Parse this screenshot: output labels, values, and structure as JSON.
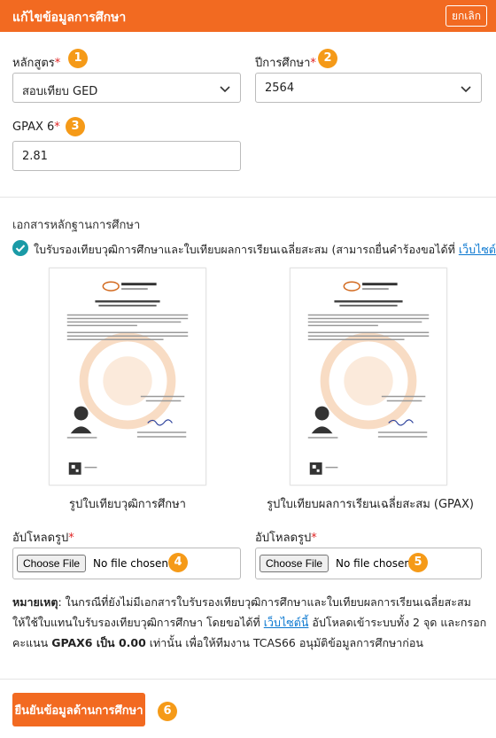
{
  "header": {
    "title": "แก้ไขข้อมูลการศึกษา",
    "cancel_label": "ยกเลิก"
  },
  "form": {
    "curriculum": {
      "label": "หลักสูตร",
      "required_mark": "*",
      "value": "สอบเทียบ GED",
      "badge": "1"
    },
    "year": {
      "label": "ปีการศึกษา",
      "required_mark": "*",
      "value": "2564",
      "badge": "2"
    },
    "gpax": {
      "label": "GPAX 6",
      "required_mark": "*",
      "value": "2.81",
      "badge": "3"
    }
  },
  "documents": {
    "section_title": "เอกสารหลักฐานการศึกษา",
    "checkbox_text_before": "ใบรับรองเทียบวุฒิการศึกษาและใบเทียบผลการเรียนเฉลี่ยสะสม (สามารถยื่นคำร้องขอได้ที่ ",
    "checkbox_link": "เว็บไซต์นี้",
    "checkbox_text_after": ")",
    "caption_left": "รูปใบเทียบวุฒิการศึกษา",
    "caption_right": "รูปใบเทียบผลการเรียนเฉลี่ยสะสม (GPAX)",
    "upload_left": {
      "label": "อัปโหลดรูป",
      "required_mark": "*",
      "button": "Choose File",
      "status": "No file chosen",
      "badge": "4"
    },
    "upload_right": {
      "label": "อัปโหลดรูป",
      "required_mark": "*",
      "button": "Choose File",
      "status": "No file chosen",
      "badge": "5"
    }
  },
  "note": {
    "prefix": "หมายเหตุ",
    "text1": ": ในกรณีที่ยังไม่มีเอกสารใบรับรองเทียบวุฒิการศึกษาและใบเทียบผลการเรียนเฉลี่ยสะสม ให้ใช้ใบแทนใบรับรองเทียบวุฒิการศึกษา โดยขอได้ที่ ",
    "link": "เว็บไซต์นี้",
    "text2": " อัปโหลดเข้าระบบทั้ง 2 จุด และกรอกคะแนน ",
    "bold": "GPAX6 เป็น 0.00",
    "text3": " เท่านั้น เพื่อให้ทีมงาน TCAS66 อนุมัติข้อมูลการศึกษาก่อน"
  },
  "footer": {
    "confirm_label": "ยืนยันข้อมูลด้านการศึกษา",
    "badge": "6"
  },
  "colors": {
    "brand": "#f26a21",
    "badge": "#f59a18",
    "check": "#1a9aa6",
    "link": "#0b78d0"
  }
}
